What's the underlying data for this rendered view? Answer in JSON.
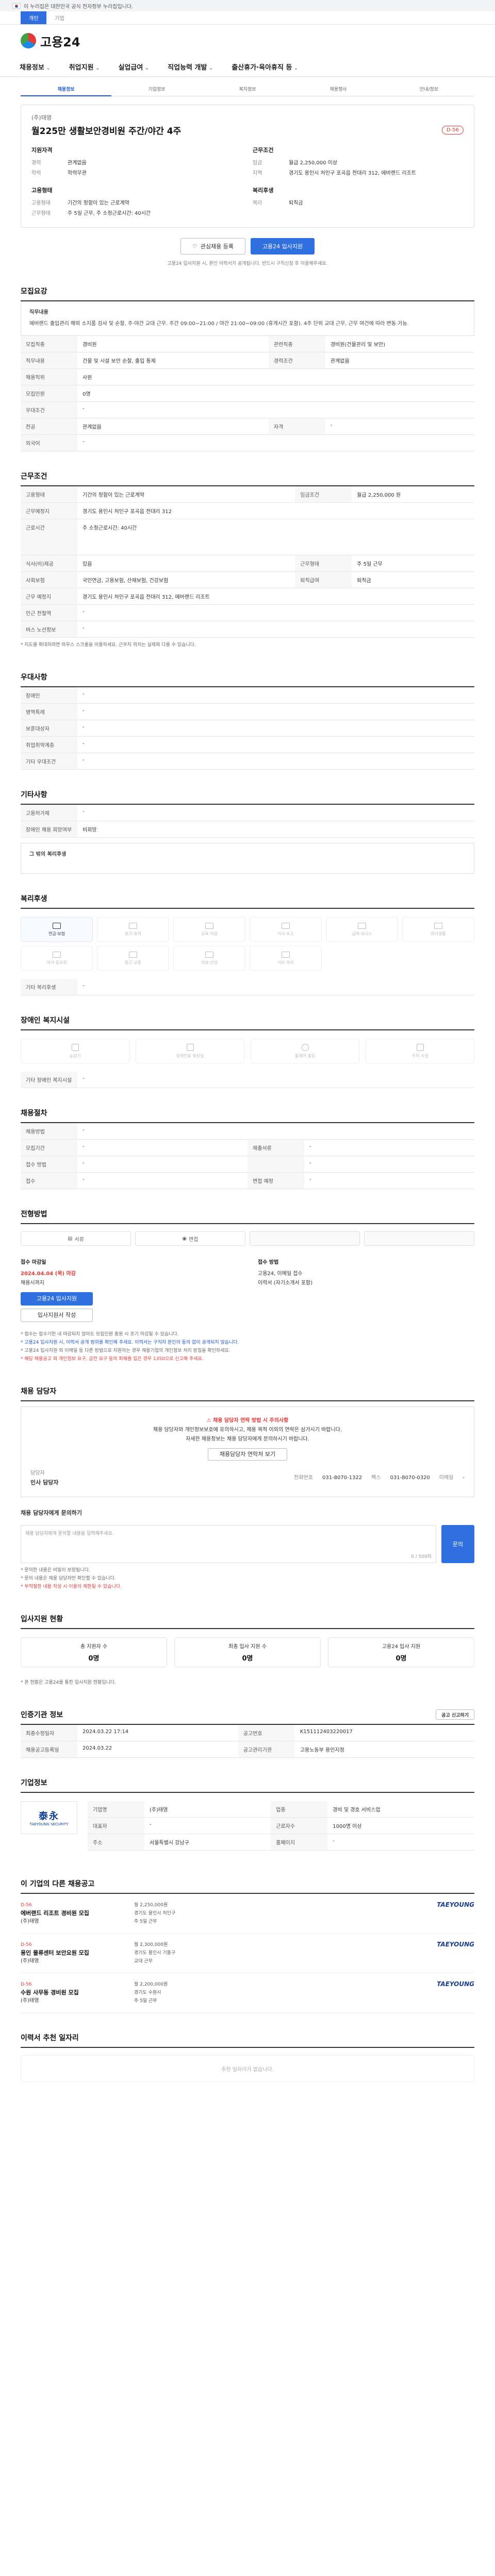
{
  "gov_banner": "이 누리집은 대한민국 공식 전자정부 누리집입니다.",
  "top_tabs": [
    "개인",
    "기업"
  ],
  "logo_text": "고용24",
  "gnb": [
    "채용정보",
    "취업지원",
    "실업급여",
    "직업능력 개발",
    "출산휴가·육아휴직 등"
  ],
  "sub_tabs": [
    "채용정보",
    "기업정보",
    "복지정보",
    "채용행사",
    "안내/정보"
  ],
  "job": {
    "company": "(주)태영",
    "title": "월225만 생활보안경비원 주간/야간 4주",
    "dday": "D-56",
    "left_heading": "지원자격",
    "right_heading": "근무조건",
    "left_rows": [
      {
        "k": "경력",
        "v": "관계없음"
      },
      {
        "k": "학력",
        "v": "학력무관"
      }
    ],
    "right_rows": [
      {
        "k": "임금",
        "v": "월급 2,250,000 이상"
      },
      {
        "k": "지역",
        "v": "경기도 용인시 처인구 포곡읍 전대리 312, 에버랜드 리조트"
      }
    ],
    "left_heading2": "고용형태",
    "left_rows2": [
      {
        "k": "고용형태",
        "v": "기간의 정함이 있는 근로계약"
      },
      {
        "k": "근무형태",
        "v": "주 5일 근무, 주 소정근로시간: 40시간"
      }
    ],
    "right_heading2": "복리후생",
    "right_rows2": [
      {
        "k": "복리",
        "v": "퇴직금"
      }
    ]
  },
  "buttons": {
    "interest": "관심채용 등록",
    "apply": "고용24 입사지원"
  },
  "notice_center": "고용24 입사지원 시, 본인 이력서가 공개됩니다. 반드시 구직신청 후 이용해주세요.",
  "recruit_section": {
    "title": "모집요강",
    "job_desc_label": "직무내용",
    "job_desc": "에버랜드 출입관리 해외 소지품 검사 및 순찰, 주·야간 교대 근무. 주간 09:00~21:00 / 야간 21:00~09:00 (휴게시간 포함). 4주 단위 교대 근무, 근무 여건에 따라 변동 가능.",
    "rows": [
      {
        "k": "모집직종",
        "v": "경비원",
        "k2": "관련직종",
        "v2": "경비원(건물관리 및 보안)"
      },
      {
        "k": "직무내용",
        "v": "건물 및 시설 보안 순찰, 출입 통제",
        "k2": "경력조건",
        "v2": "관계없음"
      },
      {
        "k": "채용직위",
        "v": "사원",
        "k2": "",
        "v2": ""
      },
      {
        "k": "모집인원",
        "v": "0명",
        "k2": "",
        "v2": ""
      },
      {
        "k": "우대조건",
        "v": "-",
        "k2": "",
        "v2": ""
      },
      {
        "k": "전공",
        "v": "관계없음",
        "k2": "자격",
        "v2": "-"
      },
      {
        "k": "외국어",
        "v": "-",
        "k2": "",
        "v2": ""
      }
    ]
  },
  "work_section": {
    "title": "근무조건",
    "rows": [
      {
        "k": "고용형태",
        "v": "기간의 정함이 있는 근로계약",
        "k2": "임금조건",
        "v2": "월급 2,250,000 원"
      },
      {
        "k": "근무예정지",
        "v": "경기도 용인시 처인구 포곡읍 전대리 312",
        "k2": "",
        "v2": ""
      },
      {
        "k": "근로시간",
        "v": "주 소정근로시간: 40시간",
        "k2": "",
        "v2": ""
      },
      {
        "k": "식사(비)제공",
        "v": "있음",
        "k2": "근무형태",
        "v2": "주 5일 근무"
      },
      {
        "k": "사회보험",
        "v": "국민연금, 고용보험, 산재보험, 건강보험",
        "k2": "퇴직급여",
        "v2": "퇴직금"
      },
      {
        "k": "근무 예정지",
        "v": "경기도 용인시 처인구 포곡읍 전대리 312, 에버랜드 리조트",
        "k2": "",
        "v2": ""
      },
      {
        "k": "인근 전철역",
        "v": "-",
        "k2": "",
        "v2": ""
      },
      {
        "k": "버스 노선정보",
        "v": "-",
        "k2": "",
        "v2": ""
      }
    ],
    "note": "* 지도를 확대하려면 마우스 스크롤을 이용하세요. 근무지 위치는 실제와 다를 수 있습니다."
  },
  "support_section": {
    "title": "우대사항",
    "rows": [
      {
        "k": "장애인",
        "v": "-"
      },
      {
        "k": "병역특례",
        "v": "-"
      },
      {
        "k": "보훈대상자",
        "v": "-"
      },
      {
        "k": "취업취약계층",
        "v": "-"
      },
      {
        "k": "기타 우대조건",
        "v": "-"
      }
    ]
  },
  "etc_section": {
    "title": "기타사항",
    "rows": [
      {
        "k": "고용허가제",
        "v": "-"
      },
      {
        "k": "장애인 채용 희망여부",
        "v": "비희망"
      }
    ],
    "extra": "그 밖의 복리후생"
  },
  "benefit_section": {
    "title": "복리후생",
    "items": [
      {
        "label": "연금·보험",
        "on": true
      },
      {
        "label": "휴가·휴직",
        "on": false
      },
      {
        "label": "교육·지원",
        "on": false
      },
      {
        "label": "식사·숙소",
        "on": false
      },
      {
        "label": "급여·보너스",
        "on": false
      },
      {
        "label": "회사생활",
        "on": false
      },
      {
        "label": "여가·동호회",
        "on": false
      },
      {
        "label": "통근·교통",
        "on": false
      },
      {
        "label": "의료·건강",
        "on": false
      },
      {
        "label": "기타 복지",
        "on": false
      }
    ],
    "extra": "기타 복리후생",
    "extra_v": "-"
  },
  "disability_section": {
    "title": "장애인 복지시설",
    "items": [
      "승강기",
      "장애인용 화장실",
      "휠체어 출입",
      "주차 시설"
    ],
    "extra": "기타 장애인 복지시설",
    "extra_v": "-"
  },
  "hiring_section": {
    "title": "채용절차",
    "rows": [
      {
        "k": "채용방법",
        "v": "-"
      },
      {
        "k": "모집기간",
        "v": "-",
        "k2": "제출서류",
        "v2": "-"
      },
      {
        "k": "접수 방법",
        "v": "-",
        "k2": "",
        "v2": "-"
      },
      {
        "k": "접수",
        "v": "-",
        "k2": "면접 예정",
        "v2": "-"
      }
    ]
  },
  "apply_section": {
    "title": "전형방법",
    "tabs": [
      "서류",
      "면접",
      "",
      ""
    ],
    "period_label": "접수 마감일",
    "period_date": "2024.04.04 (목) 마감",
    "period_sub": "채용시까지",
    "method_label": "접수 방법",
    "method_v": "고용24, 이메일 접수",
    "method_v2": "이력서 (자기소개서 포함)",
    "apply_btn": "고용24 입사지원",
    "form_btn": "입사지원서 작성",
    "bullets": [
      "* 접수는 접수기한 내 마감되지 않아도 모집인원 충원 시 조기 마감될 수 있습니다.",
      "* 고용24 입사지원 시, 이력서 공개 범위를 확인해 주세요. 이력서는 구직자 본인의 동의 없이 공개되지 않습니다.",
      "* 고용24 입사지원 외 이메일 등 다른 방법으로 지원하는 경우 채용기업의 개인정보 처리 방침을 확인하세요.",
      "* 해당 채용공고 외 개인정보 요구, 금전 요구 등의 피해를 입은 경우 1350으로 신고해 주세요."
    ]
  },
  "manager_section": {
    "title": "채용 담당자",
    "warn": "채용 담당자 연락 방법 시 주의사항",
    "desc1": "채용 담당자와 개인정보보호에 유의하시고, 채용 목적 이외의 연락은 삼가시기 바랍니다.",
    "desc2": "자세한 채용정보는 채용 담당자에게 문의하시기 바랍니다.",
    "btn": "채용담당자 연락처 보기",
    "mgr_label": "담당자",
    "mgr_name": "인사 담당자",
    "phone_label": "전화번호",
    "phone": "031-8070-1322",
    "fax_label": "팩스",
    "fax": "031-8070-0320",
    "email_label": "이메일",
    "email": "-"
  },
  "inquiry_section": {
    "title": "채용 담당자에게 문의하기",
    "placeholder": "채용 담당자에게 문의할 내용을 입력해주세요.",
    "count": "0 / 500자",
    "btn": "문의",
    "bullets": [
      "* 문의한 내용은 비밀이 보장됩니다.",
      "* 문의 내용은 채용 담당자만 확인할 수 있습니다.",
      "* 부적절한 내용 작성 시 이용이 제한될 수 있습니다."
    ]
  },
  "status_section": {
    "title": "입사지원 현황",
    "stats": [
      {
        "label": "총 지원자 수",
        "value": "0명"
      },
      {
        "label": "최종 입사 지원 수",
        "value": "0명"
      },
      {
        "label": "고용24 입사 지원",
        "value": "0명"
      }
    ],
    "note": "* 본 현황은 고용24를 통한 입사지원 현황입니다."
  },
  "reg_section": {
    "title": "인증기관 정보",
    "rows": [
      {
        "k": "최종수정일자",
        "v": "2024.03.22 17:14",
        "k2": "공고번호",
        "v2": "K151112403220017"
      },
      {
        "k": "채용공고등록일",
        "v": "2024.03.22",
        "k2": "공고관리기관",
        "v2": "고용노동부 용인지청"
      }
    ],
    "btn": "공고 신고하기"
  },
  "company_section": {
    "title": "기업정보",
    "logo_big": "泰永",
    "logo_sm": "TAEYOUNG SECURITY",
    "rows": [
      {
        "k": "기업명",
        "v": "(주)태영",
        "k2": "업종",
        "v2": "경비 및 경호 서비스업"
      },
      {
        "k": "대표자",
        "v": "-",
        "k2": "근로자수",
        "v2": "1000명 이상"
      },
      {
        "k": "주소",
        "v": "서울특별시 강남구",
        "k2": "홈페이지",
        "v2": "-"
      }
    ]
  },
  "other_section": {
    "title": "이 기업의 다른 채용공고",
    "jobs": [
      {
        "badge": "D-56",
        "title": "에버랜드 리조트 경비원 모집",
        "company": "(주)태영",
        "pay": "월 2,250,000원",
        "place": "경기도 용인시 처인구",
        "type": "주 5일 근무",
        "logo": "TAEYOUNG"
      },
      {
        "badge": "D-56",
        "title": "용인 물류센터 보안요원 모집",
        "company": "(주)태영",
        "pay": "월 2,300,000원",
        "place": "경기도 용인시 기흥구",
        "type": "교대 근무",
        "logo": "TAEYOUNG"
      },
      {
        "badge": "D-56",
        "title": "수원 사무동 경비원 모집",
        "company": "(주)태영",
        "pay": "월 2,200,000원",
        "place": "경기도 수원시",
        "type": "주 5일 근무",
        "logo": "TAEYOUNG"
      }
    ]
  },
  "recommend_section": {
    "title": "이력서 추천 일자리",
    "empty": "추천 일자리가 없습니다."
  },
  "colors": {
    "primary": "#2f6fdf",
    "accent_red": "#e53935"
  }
}
